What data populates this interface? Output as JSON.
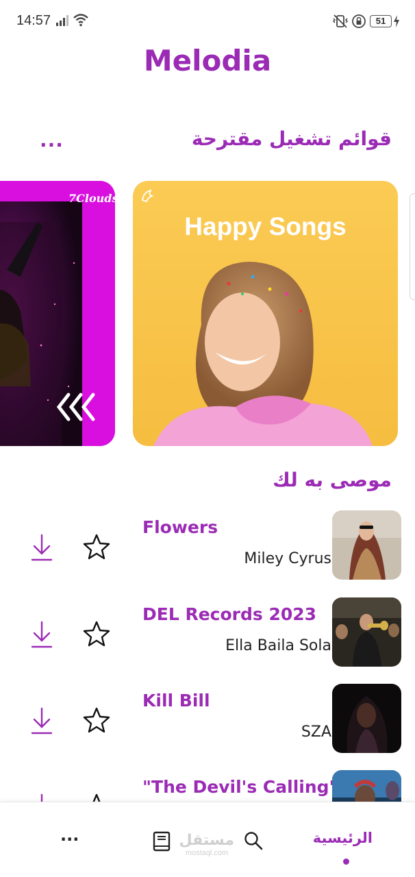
{
  "status_bar": {
    "time": "14:57",
    "battery": "51"
  },
  "app": {
    "title": "Melodia"
  },
  "playlists_section": {
    "title": "قوائم تشغيل مقترحة",
    "more": "...",
    "cards": [
      {
        "image_text": "7Clouds"
      },
      {
        "image_text": "Happy Songs"
      }
    ]
  },
  "recommended_section": {
    "title": "موصى به لك",
    "songs": [
      {
        "title": "Flowers",
        "artist": "Miley Cyrus"
      },
      {
        "title": "DEL Records 2023",
        "artist": "Ella Baila Sola"
      },
      {
        "title": "Kill Bill",
        "artist": "SZA"
      },
      {
        "title": "\"The Devil's Calling\"",
        "artist": ""
      }
    ]
  },
  "bottom_nav": {
    "more": "...",
    "library_icon": "book-icon",
    "search_icon": "search-icon",
    "home_label": "الرئيسية"
  },
  "watermark": {
    "arabic": "مستقل",
    "latin": "mostaql.com"
  },
  "colors": {
    "accent": "#9b2bb5",
    "card_yellow": "#f6bd40",
    "card_magenta": "#d90fe0"
  }
}
